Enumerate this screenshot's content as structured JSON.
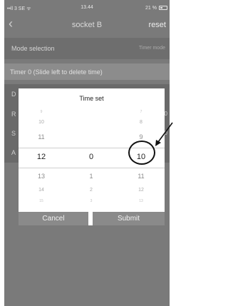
{
  "status_bar": {
    "carrier": "••ll 3 SE ᯤ",
    "time": "13.44",
    "battery": "21 %"
  },
  "nav": {
    "back_icon": "chevron-left-icon",
    "title": "socket B",
    "reset_label": "reset"
  },
  "mode_row": {
    "label": "Mode selection",
    "value": "Timer mode"
  },
  "timer_header": "Timer 0 (Slide left to delete time)",
  "background_rows": [
    {
      "letter": "D",
      "right": ""
    },
    {
      "letter": "R",
      "right": "0"
    },
    {
      "letter": "S",
      "right": "0"
    },
    {
      "letter": "A",
      "right": ""
    }
  ],
  "add_icon": "plus-circle-icon",
  "time_set_modal": {
    "title": "Time set",
    "hours": [
      "9",
      "10",
      "11",
      "12",
      "13",
      "14",
      "15"
    ],
    "minutes": [
      "",
      "",
      "",
      "0",
      "1",
      "2",
      "3"
    ],
    "seconds": [
      "7",
      "8",
      "9",
      "10",
      "11",
      "12",
      "13"
    ],
    "selected": {
      "hour": "12",
      "minute": "0",
      "second": "10"
    },
    "cancel_label": "Cancel",
    "submit_label": "Submit"
  },
  "colors": {
    "overlay": "#7a7a7a",
    "modal_bg": "#ffffff",
    "button_bg": "#8a8a8a",
    "annotation": "#111111"
  }
}
